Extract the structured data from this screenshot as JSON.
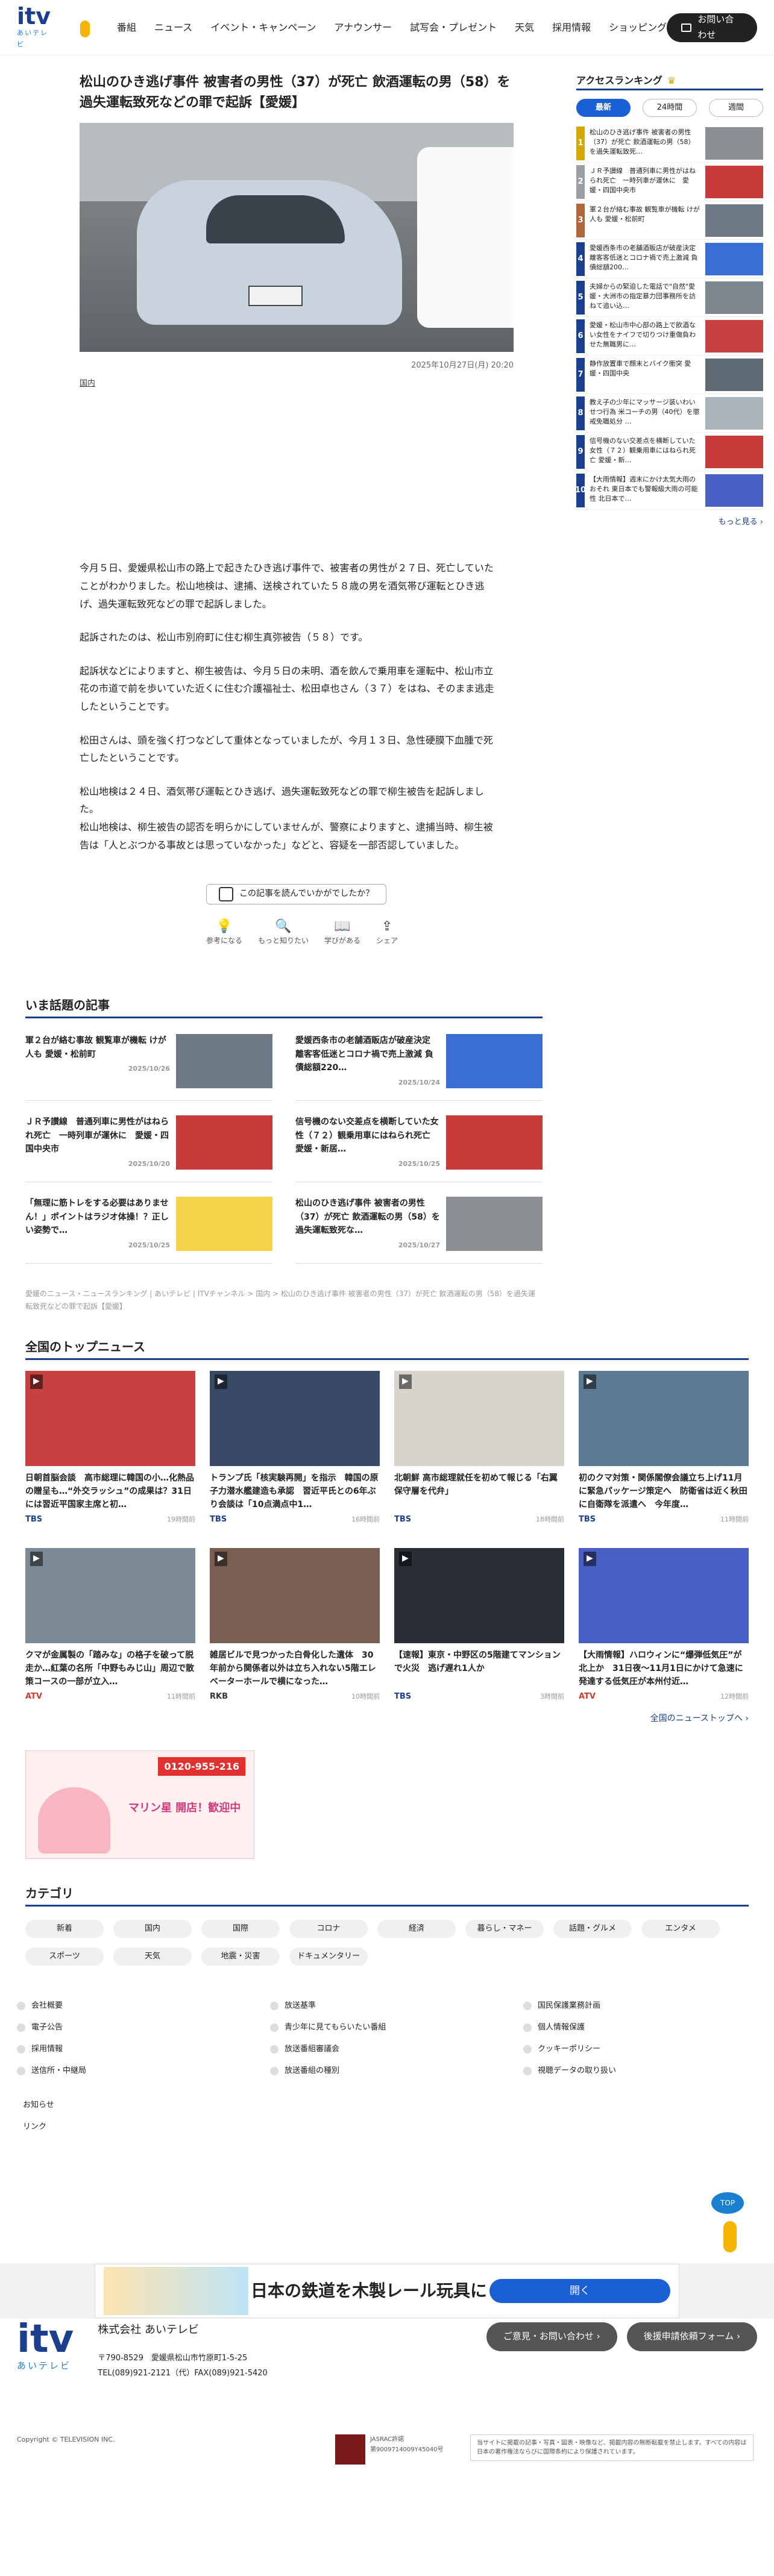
{
  "header": {
    "logo_text": "itv",
    "logo_sub": "あいテレビ",
    "nav": [
      "番組",
      "ニュース",
      "イベント・キャンペーン",
      "アナウンサー",
      "試写会・プレゼント",
      "天気",
      "採用情報",
      "ショッピング"
    ],
    "contact": "お問い合わせ"
  },
  "article": {
    "title": "松山のひき逃げ事件 被害者の男性（37）が死亡 飲酒運転の男（58）を過失運転致死などの罪で起訴【愛媛】",
    "date": "2025年10月27日(月) 20:20",
    "category": "国内",
    "paragraphs": [
      "今月５日、愛媛県松山市の路上で起きたひき逃げ事件で、被害者の男性が２７日、死亡していたことがわかりました。松山地検は、逮捕、送検されていた５８歳の男を酒気帯び運転とひき逃げ、過失運転致死などの罪で起訴しました。",
      "起訴されたのは、松山市別府町に住む柳生真弥被告（５８）です。",
      "起訴状などによりますと、柳生被告は、今月５日の未明、酒を飲んで乗用車を運転中、松山市立花の市道で前を歩いていた近くに住む介護福祉士、松田卓也さん（３７）をはね、そのまま逃走したということです。",
      "松田さんは、頭を強く打つなどして重体となっていましたが、今月１３日、急性硬膜下血腫で死亡したということです。",
      "松山地検は２４日、酒気帯び運転とひき逃げ、過失運転致死などの罪で柳生被告を起訴しました。\n松山地検は、柳生被告の認否を明らかにしていませんが、警察によりますと、逮捕当時、柳生被告は「人とぶつかる事故とは思っていなかった」などと、容疑を一部否認していました。"
    ],
    "question": "この記事を読んでいかがでしたか？",
    "reactions": [
      "参考になる",
      "もっと知りたい",
      "学びがある",
      "シェア"
    ]
  },
  "hot_topics": {
    "heading": "いま話題の記事",
    "items": [
      {
        "title": "軍２台が絡む事故 観覧車が機転 けが人も 愛媛・松前町",
        "date": "2025/10/26",
        "color": "#6d7a86"
      },
      {
        "title": "愛媛西条市の老舗酒販店が破産決定 離客客低迷とコロナ禍で売上激減 負債総額220…",
        "date": "2025/10/24",
        "color": "#3a6ed4"
      },
      {
        "title": "ＪＲ予讃線　普通列車に男性がはねられ死亡　一時列車が運休に　愛媛・四国中央市",
        "date": "2025/10/20",
        "color": "#c73a3a"
      },
      {
        "title": "信号機のない交差点を横断していた女性（７２）観乗用車にはねられ死亡 愛媛・新居…",
        "date": "2025/10/25",
        "color": "#c73a3a"
      },
      {
        "title": "「無理に筋トレをする必要はありません！」ポイントはラジオ体操！？正しい姿勢で…",
        "date": "2025/10/25",
        "color": "#f5d34a"
      },
      {
        "title": "松山のひき逃げ事件 被害者の男性（37）が死亡 飲酒運転の男（58）を過失運転致死な…",
        "date": "2025/10/27",
        "color": "#8b8f92"
      }
    ]
  },
  "breadcrumb": "愛媛のニュース・ニュースランキング | あいテレビ | ITVチャンネル > 国内 > 松山のひき逃げ事件 被害者の男性（37）が死亡 飲酒運転の男（58）を過失運転致死などの罪で起訴【愛媛】",
  "top_news": {
    "heading": "全国のトップニュース",
    "items": [
      {
        "title": "日朝首脳会談　高市総理に韓国の小…化熱品の贈呈も…“外交ラッシュ”の成果は？31日には習近平国家主席と初…",
        "src": "TBS",
        "date": "19時間前",
        "color": "#c94040"
      },
      {
        "title": "トランプ氏「核実験再開」を指示　韓国の原子力潜水艦建造も承認　習近平氏との6年ぶり会談は「10点満点中1…",
        "src": "TBS",
        "date": "16時間前",
        "color": "#3a4a66"
      },
      {
        "title": "北朝鮮 高市総理就任を初めて報じる「右翼保守層を代弁」",
        "src": "TBS",
        "date": "18時間前",
        "color": "#d7d4cc"
      },
      {
        "title": "初のクマ対策・関係閣僚会議立ち上げ11月に緊急パッケージ策定へ　防衛省は近く秋田に自衛隊を派遣へ　今年度…",
        "src": "TBS",
        "date": "11時間前",
        "color": "#5c7a92"
      },
      {
        "title": "クマが金属製の「踏みな」の格子を破って脱走か…紅葉の名所「中野もみじ山」周辺で散策コースの一部が立入…",
        "src": "ATV",
        "date": "11時間前",
        "color": "#7b8a94"
      },
      {
        "title": "雑居ビルで見つかった白骨化した遺体　30年前から関係者以外は立ち入れない5階エレベーターホールで横になった…",
        "src": "RKB",
        "date": "10時間前",
        "color": "#7a5e52"
      },
      {
        "title": "【速報】東京・中野区の5階建てマンションで火災　逃げ遅れ1人か",
        "src": "TBS",
        "date": "3時間前",
        "color": "#2a2e35"
      },
      {
        "title": "【大雨情報】ハロウィンに“爆弾低気圧”が北上か　31日夜〜11月1日にかけて急速に発達する低気圧が本州付近…",
        "src": "ATV",
        "date": "12時間前",
        "color": "#4a5fc4"
      }
    ],
    "more": "全国のニューストップへ"
  },
  "ad_banner": {
    "phone": "0120-955-216",
    "text": "マリン星 開店！歓迎中"
  },
  "categories": {
    "heading": "カテゴリ",
    "items": [
      "新着",
      "国内",
      "国際",
      "コロナ",
      "経済",
      "暮らし・マネー",
      "話題・グルメ",
      "エンタメ",
      "スポーツ",
      "天気",
      "地震・災害",
      "ドキュメンタリー"
    ]
  },
  "footer_links": {
    "grid": [
      "会社概要",
      "放送基準",
      "国民保護業務計画",
      "電子公告",
      "青少年に見てもらいたい番組",
      "個人情報保護",
      "採用情報",
      "放送番組審議会",
      "クッキーポリシー",
      "送信所・中継局",
      "放送番組の種別",
      "視聴データの取り扱い"
    ],
    "extra": [
      "お知らせ",
      "リンク"
    ]
  },
  "bottom_ad": {
    "text": "日本の鉄道を木製レール玩具に",
    "button": "開く"
  },
  "footer": {
    "logo_text": "itv",
    "logo_sub": "あいテレビ",
    "company": "株式会社 あいテレビ",
    "address": "〒790-8529　愛媛県松山市竹原町1-5-25",
    "tel": "TEL(089)921-2121（代）FAX(089)921-5420",
    "btn1": "ご意見・お問い合わせ",
    "btn2": "後援申請依頼フォーム",
    "copyright": "Copyright © TELEVISION INC.",
    "jasrac": "JASRAC許諾",
    "jasrac_no": "第9009714009Y45040号",
    "notice": "当サイトに掲載の記事・写真・図表・映像など、掲載内容の無断転載を禁止します。すべての内容は日本の著作権法ならびに国際条約により保護されています。",
    "top": "TOP"
  },
  "ranking": {
    "heading": "アクセスランキング",
    "tabs": [
      "最新",
      "24時間",
      "週間"
    ],
    "items": [
      {
        "n": "1",
        "title": "松山のひき逃げ事件 被害者の男性（37）が死亡 飲酒運転の男（58）を過失運転致死…",
        "color": "#8b8f92",
        "ncolor": "#d4a800"
      },
      {
        "n": "2",
        "title": "ＪＲ予讃線　普通列車に男性がはねられ死亡　一時列車が運休に　愛媛・四国中央市",
        "color": "#c73a3a",
        "ncolor": "#9aa0a6"
      },
      {
        "n": "3",
        "title": "軍２台が絡む事故 観覧車が機転 けが人も 愛媛・松前町",
        "color": "#6d7a86",
        "ncolor": "#b0683a"
      },
      {
        "n": "4",
        "title": "愛媛西条市の老舗酒販店が破産決定 離客客低迷とコロナ禍で売上激減 負債総額200…",
        "color": "#3a6ed4",
        "ncolor": "#1b3f8f"
      },
      {
        "n": "5",
        "title": "夫婦からの緊迫した電話で\"自然\"愛媛・大洲市の指定暴力団事務所を訪ねて追い込…",
        "color": "#7c8790",
        "ncolor": "#1b3f8f"
      },
      {
        "n": "6",
        "title": "愛媛・松山市中心部の路上で飲酒ない女性をナイフで切りつけ重傷負わせた無職男に…",
        "color": "#c94040",
        "ncolor": "#1b3f8f"
      },
      {
        "n": "7",
        "title": "静作放置車で顔末とバイク衝突 愛媛・四国中央",
        "color": "#5f6b74",
        "ncolor": "#1b3f8f"
      },
      {
        "n": "8",
        "title": "教え子の少年にマッサージ装いわいせつ行為 米コーチの男（40代）を懲戒免職処分 …",
        "color": "#a9b4bc",
        "ncolor": "#1b3f8f"
      },
      {
        "n": "9",
        "title": "信号機のない交差点を横断していた女性（７２）観乗用車にはねられ死亡 愛媛・新…",
        "color": "#c73a3a",
        "ncolor": "#1b3f8f"
      },
      {
        "n": "10",
        "title": "【大雨情報】週末にかけ太気大雨のおそれ 東日本でも警報級大雨の可能性 北日本で…",
        "color": "#4a5fc4",
        "ncolor": "#1b3f8f"
      }
    ],
    "more": "もっと見る"
  }
}
